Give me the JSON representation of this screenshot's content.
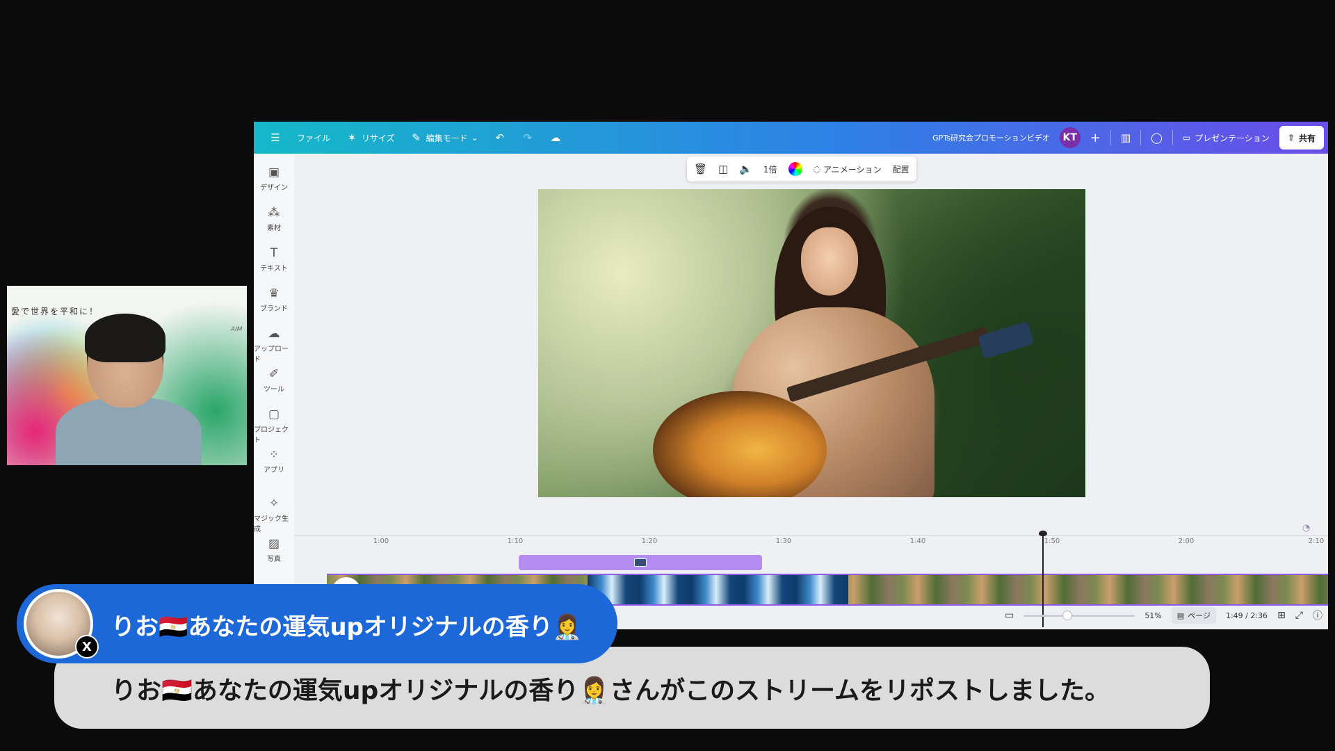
{
  "topbar": {
    "file_label": "ファイル",
    "resize_label": "リサイズ",
    "edit_mode_label": "編集モード",
    "project_title": "GPTs研究会プロモーションビデオ",
    "avatar_initials": "KT",
    "present_label": "プレゼンテーション",
    "share_label": "共有"
  },
  "sidebar": {
    "items": [
      {
        "label": "デザイン",
        "icon": "design-icon"
      },
      {
        "label": "素材",
        "icon": "elements-icon"
      },
      {
        "label": "テキスト",
        "icon": "text-icon"
      },
      {
        "label": "ブランド",
        "icon": "brand-icon"
      },
      {
        "label": "アップロード",
        "icon": "upload-icon"
      },
      {
        "label": "ツール",
        "icon": "tools-icon"
      },
      {
        "label": "プロジェクト",
        "icon": "projects-icon"
      },
      {
        "label": "アプリ",
        "icon": "apps-icon"
      },
      {
        "label": "マジック生成",
        "icon": "magic-icon"
      },
      {
        "label": "写真",
        "icon": "photos-icon"
      }
    ]
  },
  "float_toolbar": {
    "speed_label": "1倍",
    "animation_label": "アニメーション",
    "arrange_label": "配置"
  },
  "timeline": {
    "ticks": [
      "1:00",
      "1:10",
      "1:20",
      "1:30",
      "1:40",
      "1:50",
      "2:00",
      "2:10"
    ]
  },
  "bottombar": {
    "zoom": "51%",
    "page_label": "ページ",
    "time": "1:49 / 2:36",
    "zoom_fraction": 0.38
  },
  "webcam": {
    "banner_text": "愛で世界を平和に！",
    "corner_text": "AIM"
  },
  "notification": {
    "name": "りお🇪🇬あなたの運気upオリジナルの香り👩‍⚕️",
    "message": "りお🇪🇬あなたの運気upオリジナルの香り👩‍⚕️さんがこのストリームをリポストしました。",
    "badge": "X"
  },
  "colors": {
    "topbar_start": "#15b8c8",
    "topbar_end": "#6a4de8",
    "name_pill": "#1d68d8",
    "audio_track": "#b58cf2"
  }
}
